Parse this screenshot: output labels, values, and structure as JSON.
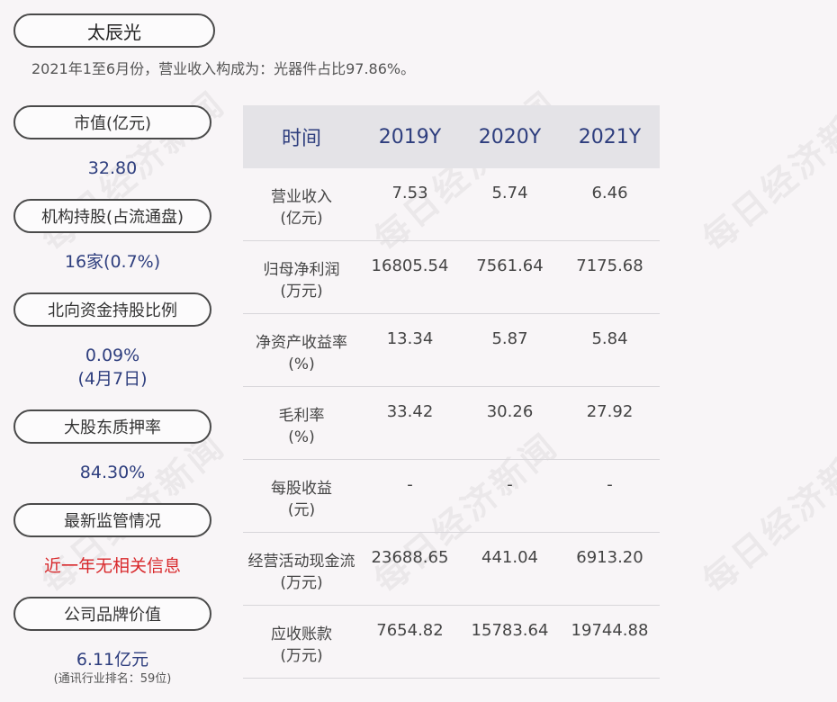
{
  "company": "太辰光",
  "subtitle": "2021年1至6月份，营业收入构成为：光器件占比97.86%。",
  "left_panel": [
    {
      "label": "市值(亿元)",
      "value": "32.80"
    },
    {
      "label": "机构持股(占流通盘)",
      "value": "16家(0.7%)"
    },
    {
      "label": "北向资金持股比例",
      "value": "0.09%",
      "value2": "(4月7日)"
    },
    {
      "label": "大股东质押率",
      "value": "84.30%"
    },
    {
      "label": "最新监管情况",
      "value": "近一年无相关信息"
    },
    {
      "label": "公司品牌价值",
      "value": "6.11亿元",
      "value2": "(通讯行业排名：59位)"
    }
  ],
  "table": {
    "headers": [
      "时间",
      "2019Y",
      "2020Y",
      "2021Y"
    ],
    "rows": [
      {
        "name": "营业收入",
        "unit": "(亿元)",
        "values": [
          "7.53",
          "5.74",
          "6.46"
        ]
      },
      {
        "name": "归母净利润",
        "unit": "(万元)",
        "values": [
          "16805.54",
          "7561.64",
          "7175.68"
        ]
      },
      {
        "name": "净资产收益率",
        "unit": "(%)",
        "values": [
          "13.34",
          "5.87",
          "5.84"
        ]
      },
      {
        "name": "毛利率",
        "unit": "(%)",
        "values": [
          "33.42",
          "30.26",
          "27.92"
        ]
      },
      {
        "name": "每股收益",
        "unit": "(元)",
        "values": [
          "-",
          "-",
          "-"
        ]
      },
      {
        "name": "经营活动现金流",
        "unit": "(万元)",
        "values": [
          "23688.65",
          "441.04",
          "6913.20"
        ]
      },
      {
        "name": "应收账款",
        "unit": "(万元)",
        "values": [
          "7654.82",
          "15783.64",
          "19744.88"
        ]
      }
    ]
  },
  "watermark": "每日经济新闻",
  "colors": {
    "value_blue": "#2e3e7e",
    "alert_red": "#d8282b",
    "header_bg": "#e4e3e7"
  }
}
